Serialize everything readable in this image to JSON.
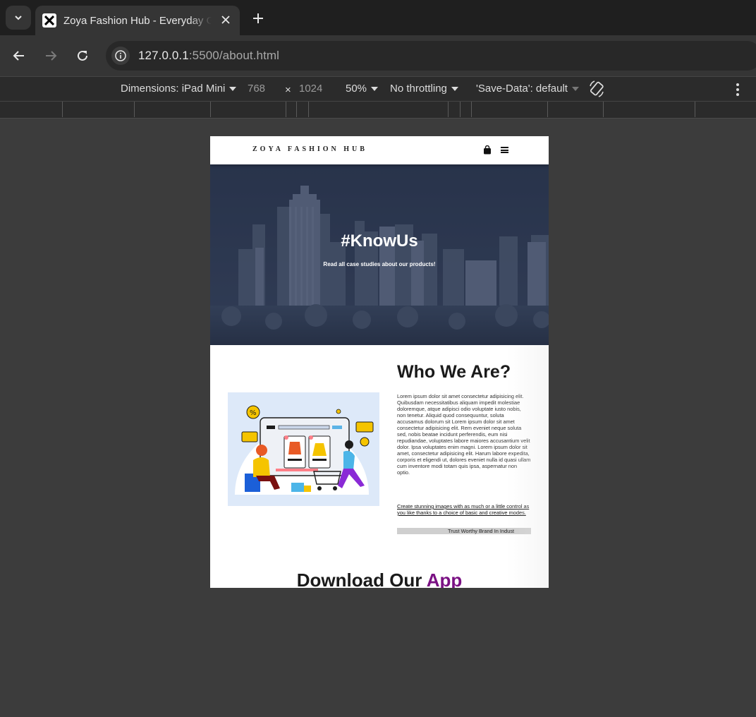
{
  "browser": {
    "tab": {
      "title": "Zoya Fashion Hub - Everyday Gr"
    },
    "address": {
      "host": "127.0.0.1",
      "path": ":5500/about.html"
    }
  },
  "devtools": {
    "dimensions_label": "Dimensions: iPad Mini",
    "width": "768",
    "times": "×",
    "height": "1024",
    "zoom": "50%",
    "throttling": "No throttling",
    "save_data": "'Save-Data': default"
  },
  "site": {
    "logo": "ZOYA FASHION HUB",
    "hero": {
      "title": "#KnowUs",
      "subtitle": "Read all case studies about our products!"
    },
    "about": {
      "title": "Who We Are?",
      "body": "Lorem ipsum dolor sit amet consectetur adipisicing elit. Quibusdam necessitatibus aliquam impedit molestiae doloremque, atque adipisci odio voluptate iusto nobis, non tenetur. Aliquid quod consequuntur, soluta accusamus dolorum sit Lorem ipsum dolor sit amet consectetur adipisicing elit. Rem eveniet neque soluta sed, nobis beatae incidunt perferendis, eum nisi repudiandae, voluptates labore maiores accusantium velit dolor. Ipsa voluptates enim magni. Lorem ipsum dolor sit amet, consectetur adipisicing elit. Harum labore expedita, corporis et eligendi ut, dolores eveniet nulla id quasi ullam cum inventore modi totam quis ipsa, aspernatur non optio.",
      "note": "Create stunning images with as much or a little control as you like thanks to a choice of basic and creative modes.",
      "marquee": "Trust Worthy Brand In Indust"
    },
    "download": {
      "title": "Download Our ",
      "accent": "App"
    }
  }
}
